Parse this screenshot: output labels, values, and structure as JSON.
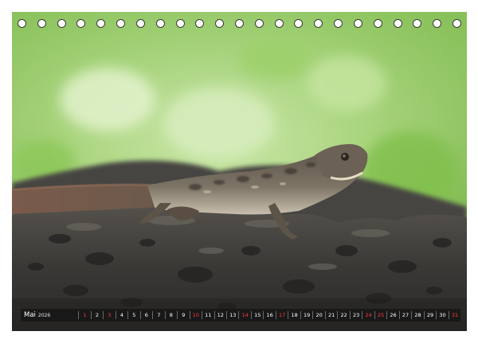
{
  "calendar": {
    "month": "Mai",
    "year": "2026",
    "days": [
      {
        "d": "1",
        "red": true
      },
      {
        "d": "2",
        "red": false
      },
      {
        "d": "3",
        "red": true
      },
      {
        "d": "4",
        "red": false
      },
      {
        "d": "5",
        "red": false
      },
      {
        "d": "6",
        "red": false
      },
      {
        "d": "7",
        "red": false
      },
      {
        "d": "8",
        "red": false
      },
      {
        "d": "9",
        "red": false
      },
      {
        "d": "10",
        "red": true
      },
      {
        "d": "11",
        "red": false
      },
      {
        "d": "12",
        "red": false
      },
      {
        "d": "13",
        "red": false
      },
      {
        "d": "14",
        "red": true
      },
      {
        "d": "15",
        "red": false
      },
      {
        "d": "16",
        "red": false
      },
      {
        "d": "17",
        "red": true
      },
      {
        "d": "18",
        "red": false
      },
      {
        "d": "19",
        "red": false
      },
      {
        "d": "20",
        "red": false
      },
      {
        "d": "21",
        "red": false
      },
      {
        "d": "22",
        "red": false
      },
      {
        "d": "23",
        "red": false
      },
      {
        "d": "24",
        "red": true
      },
      {
        "d": "25",
        "red": true
      },
      {
        "d": "26",
        "red": false
      },
      {
        "d": "27",
        "red": false
      },
      {
        "d": "28",
        "red": false
      },
      {
        "d": "29",
        "red": false
      },
      {
        "d": "30",
        "red": false
      },
      {
        "d": "31",
        "red": true
      }
    ],
    "weekend_color": "#ff3b3b",
    "day_color": "#ffffff"
  },
  "photo": {
    "subject": "lizard-on-rock",
    "background_color": "#9fd27a",
    "rock_color": "#3b3a38"
  },
  "binding": {
    "ring_count": 23
  }
}
